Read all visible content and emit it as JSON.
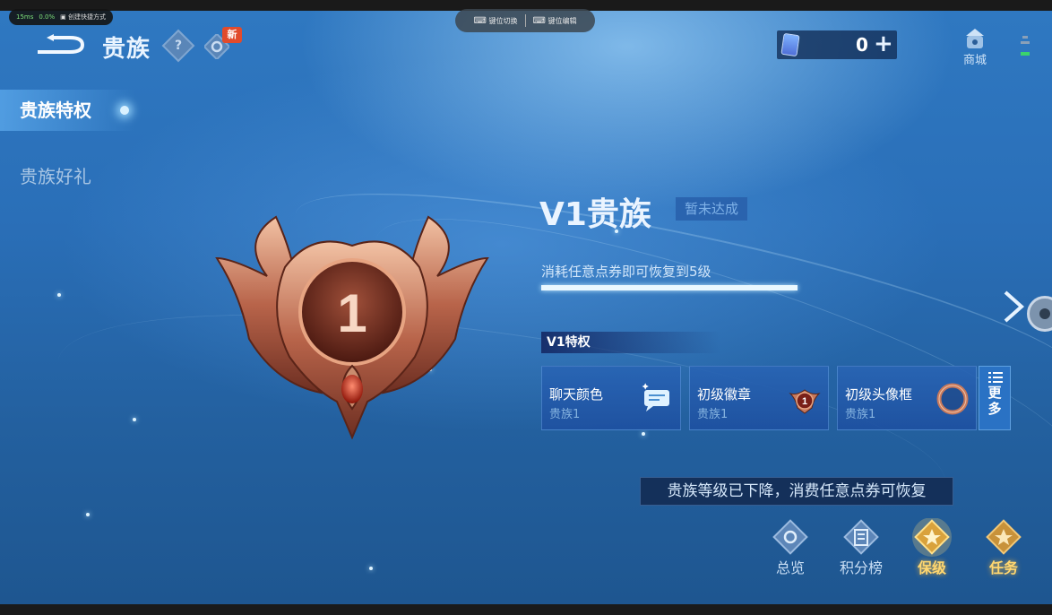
{
  "overlay": {
    "ping": "15ms",
    "loss": "0.0%",
    "shortcut_label": "创建快捷方式",
    "keymap_switch": "键位切换",
    "keymap_edit": "键位编辑"
  },
  "header": {
    "title": "贵族",
    "new_badge": "新",
    "currency_value": "0",
    "currency_plus": "+",
    "shop_label": "商城"
  },
  "sidebar": {
    "items": [
      {
        "label": "贵族特权",
        "active": true
      },
      {
        "label": "贵族好礼",
        "active": false
      }
    ]
  },
  "emblem": {
    "level_number": "1"
  },
  "vip": {
    "title": "V1贵族",
    "status": "暂未达成",
    "restore_hint": "消耗任意点券即可恢复到5级",
    "progress": 1.0
  },
  "privileges": {
    "header": "V1特权",
    "cards": [
      {
        "title": "聊天颜色",
        "sub": "贵族1",
        "icon": "chat-bubble-icon"
      },
      {
        "title": "初级徽章",
        "sub": "贵族1",
        "icon": "badge-icon",
        "badge_number": "1"
      },
      {
        "title": "初级头像框",
        "sub": "贵族1",
        "icon": "avatar-frame-icon"
      }
    ],
    "more_label_1": "更",
    "more_label_2": "多"
  },
  "toast": "贵族等级已下降，消费任意点券可恢复",
  "bottom_nav": [
    {
      "label": "总览",
      "icon": "overview-icon"
    },
    {
      "label": "积分榜",
      "icon": "leaderboard-icon"
    },
    {
      "label": "保级",
      "icon": "retain-level-icon",
      "active": true
    },
    {
      "label": "任务",
      "icon": "task-icon"
    }
  ],
  "colors": {
    "background": "#2a6fb8",
    "accent_gold": "#ffd770",
    "bronze": "#b8644a"
  }
}
